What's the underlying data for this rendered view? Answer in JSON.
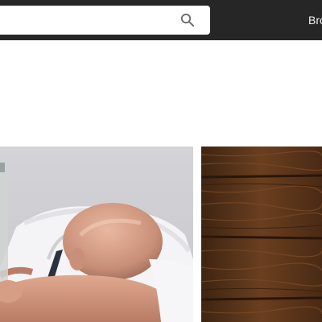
{
  "header": {
    "search": {
      "value": "",
      "placeholder": ""
    },
    "search_icon": "search-icon",
    "nav": [
      {
        "label": "Bro"
      }
    ],
    "background": "#262626"
  },
  "gallery": {
    "images": [
      {
        "name": "man-sleeping-on-desk-with-bottle",
        "dominant_color": "#d7d7d9"
      },
      {
        "name": "dark-wood-planks-texture",
        "dominant_color": "#4a2a14"
      }
    ]
  }
}
